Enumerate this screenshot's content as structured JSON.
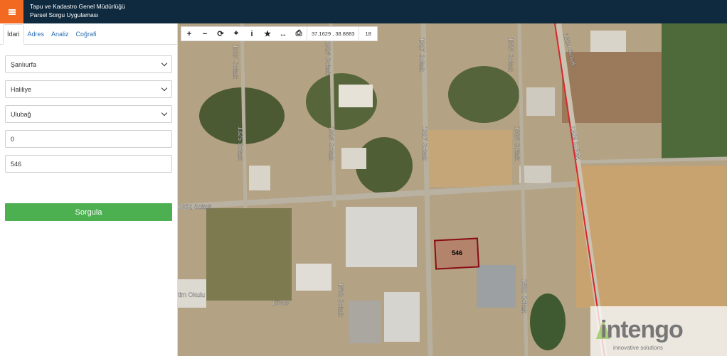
{
  "header": {
    "org_title": "Tapu ve Kadastro Genel Müdürlüğü",
    "app_title": "Parsel Sorgu Uygulaması",
    "menu_icon": "hamburger-icon"
  },
  "sidebar": {
    "tabs": [
      {
        "label": "İdari",
        "active": true
      },
      {
        "label": "Adres",
        "active": false
      },
      {
        "label": "Analiz",
        "active": false
      },
      {
        "label": "Coğrafi",
        "active": false
      }
    ],
    "province": "Şanlıurfa",
    "district": "Haliliye",
    "neighborhood": "Ulubağ",
    "block_no": "0",
    "parcel_no": "546",
    "query_button": "Sorgula"
  },
  "toolbar": {
    "icons": [
      "zoom-in-icon",
      "zoom-out-icon",
      "refresh-icon",
      "locate-icon",
      "info-icon",
      "favorite-icon",
      "measure-icon",
      "print-icon"
    ],
    "coordinates": "37.1629 , 38.8883",
    "zoom_level": "18"
  },
  "map": {
    "street_labels": [
      "1325 Sokak",
      "1326 Sokak",
      "1327 Sokak",
      "1328 Sokak",
      "1329 Sokak",
      "1325 Sokak",
      "1326 Sokak",
      "1327 Sokak",
      "1328 Sokak",
      "1329 Sokak",
      "1302 Sokak",
      "16325",
      "1632 Sokak",
      "1632 Sokak"
    ],
    "poi_label": "tim Okulu",
    "parcel_label": "546"
  },
  "watermark": {
    "brand": "intengo",
    "tagline": "innovative solutions"
  }
}
